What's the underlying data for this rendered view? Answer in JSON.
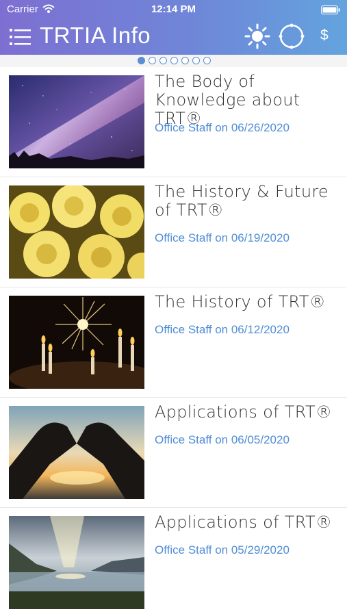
{
  "status_bar": {
    "carrier": "Carrier",
    "time": "12:14 PM"
  },
  "navbar": {
    "title": "TRTIA Info",
    "menu_icon": "list-icon",
    "theme_icon": "sun-icon",
    "circle_icon": "circle-icon",
    "dollar_label": "$"
  },
  "pager": {
    "count": 7,
    "active_index": 0
  },
  "colors": {
    "header_start": "#7d6fd1",
    "header_end": "#63a4de",
    "meta_blue": "#4f8dd6"
  },
  "posts": [
    {
      "title": "The Body of Knowledge about TRT®",
      "meta": "Office Staff on 06/26/2020",
      "thumbnail": "milky-way-night-sky"
    },
    {
      "title": "The History & Future of TRT®",
      "meta": "Office Staff on 06/19/2020",
      "thumbnail": "yellow-roses"
    },
    {
      "title": "The History of TRT®",
      "meta": "Office Staff on 06/12/2020",
      "thumbnail": "sparkler-candles"
    },
    {
      "title": "Applications of TRT®",
      "meta": "Office Staff on 06/05/2020",
      "thumbnail": "heart-hands-sunset"
    },
    {
      "title": "Applications of TRT®",
      "meta": "Office Staff on 05/29/2020",
      "thumbnail": "fjord-sunbeam"
    }
  ]
}
